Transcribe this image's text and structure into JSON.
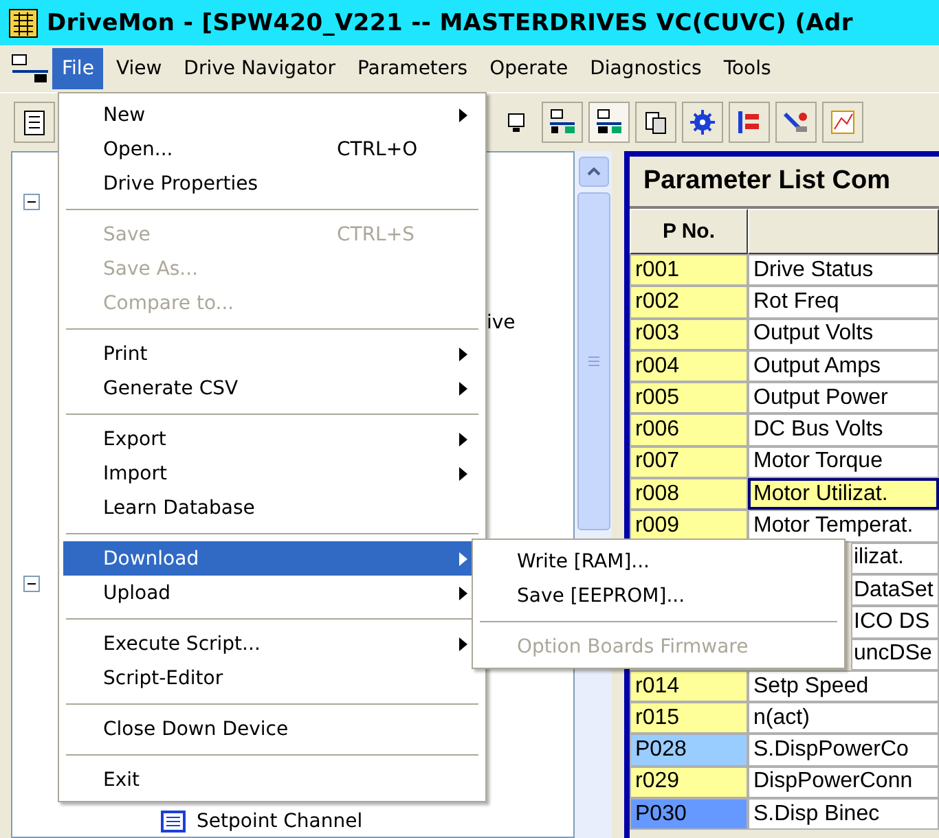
{
  "window": {
    "title": "DriveMon - [SPW420_V221 -- MASTERDRIVES VC(CUVC)  (Adr"
  },
  "menubar": [
    {
      "label": "File",
      "selected": true
    },
    {
      "label": "View",
      "selected": false
    },
    {
      "label": "Drive Navigator",
      "selected": false
    },
    {
      "label": "Parameters",
      "selected": false
    },
    {
      "label": "Operate",
      "selected": false
    },
    {
      "label": "Diagnostics",
      "selected": false
    },
    {
      "label": "Tools",
      "selected": false
    }
  ],
  "tree": {
    "nodes": [
      {
        "expanded": true
      },
      {
        "expanded": true
      }
    ],
    "fragment": "ive",
    "items": [
      {
        "label": "Setpoint Channel"
      }
    ]
  },
  "file_menu": {
    "items": [
      {
        "kind": "item",
        "label": "New",
        "submenu": true,
        "disabled": false,
        "selected": false
      },
      {
        "kind": "item",
        "label": "Open...",
        "shortcut": "CTRL+O",
        "submenu": false,
        "disabled": false,
        "selected": false
      },
      {
        "kind": "item",
        "label": "Drive Properties",
        "submenu": false,
        "disabled": false,
        "selected": false
      },
      {
        "kind": "separator"
      },
      {
        "kind": "item",
        "label": "Save",
        "shortcut": "CTRL+S",
        "submenu": false,
        "disabled": true,
        "selected": false
      },
      {
        "kind": "item",
        "label": "Save As...",
        "submenu": false,
        "disabled": true,
        "selected": false
      },
      {
        "kind": "item",
        "label": "Compare to...",
        "submenu": false,
        "disabled": true,
        "selected": false
      },
      {
        "kind": "separator"
      },
      {
        "kind": "item",
        "label": "Print",
        "submenu": true,
        "disabled": false,
        "selected": false
      },
      {
        "kind": "item",
        "label": "Generate CSV",
        "submenu": true,
        "disabled": false,
        "selected": false
      },
      {
        "kind": "separator"
      },
      {
        "kind": "item",
        "label": "Export",
        "submenu": true,
        "disabled": false,
        "selected": false
      },
      {
        "kind": "item",
        "label": "Import",
        "submenu": true,
        "disabled": false,
        "selected": false
      },
      {
        "kind": "item",
        "label": "Learn Database",
        "submenu": false,
        "disabled": false,
        "selected": false
      },
      {
        "kind": "separator"
      },
      {
        "kind": "item",
        "label": "Download",
        "submenu": true,
        "disabled": false,
        "selected": true
      },
      {
        "kind": "item",
        "label": "Upload",
        "submenu": true,
        "disabled": false,
        "selected": false
      },
      {
        "kind": "separator"
      },
      {
        "kind": "item",
        "label": "Execute Script...",
        "submenu": true,
        "disabled": false,
        "selected": false
      },
      {
        "kind": "item",
        "label": "Script-Editor",
        "submenu": false,
        "disabled": false,
        "selected": false
      },
      {
        "kind": "separator"
      },
      {
        "kind": "item",
        "label": "Close Down Device",
        "submenu": false,
        "disabled": false,
        "selected": false
      },
      {
        "kind": "separator"
      },
      {
        "kind": "item",
        "label": "Exit",
        "submenu": false,
        "disabled": false,
        "selected": false
      }
    ]
  },
  "download_submenu": {
    "items": [
      {
        "kind": "item",
        "label": "Write [RAM]...",
        "disabled": false,
        "selected": false
      },
      {
        "kind": "item",
        "label": "Save [EEPROM]...",
        "disabled": false,
        "selected": false
      },
      {
        "kind": "separator"
      },
      {
        "kind": "item",
        "label": "Option Boards Firmware",
        "disabled": true,
        "selected": false
      }
    ]
  },
  "parameter_list": {
    "title": "Parameter List Com",
    "columns": [
      "P No."
    ],
    "rows": [
      {
        "p_no": "r001",
        "description": "Drive Status",
        "color": "#ffff99",
        "selected": false,
        "partly_hidden": false
      },
      {
        "p_no": "r002",
        "description": "Rot Freq",
        "color": "#ffff99",
        "selected": false,
        "partly_hidden": false
      },
      {
        "p_no": "r003",
        "description": "Output Volts",
        "color": "#ffff99",
        "selected": false,
        "partly_hidden": false
      },
      {
        "p_no": "r004",
        "description": "Output Amps",
        "color": "#ffff99",
        "selected": false,
        "partly_hidden": false
      },
      {
        "p_no": "r005",
        "description": "Output Power",
        "color": "#ffff99",
        "selected": false,
        "partly_hidden": false
      },
      {
        "p_no": "r006",
        "description": "DC Bus Volts",
        "color": "#ffff99",
        "selected": false,
        "partly_hidden": false
      },
      {
        "p_no": "r007",
        "description": "Motor Torque",
        "color": "#ffff99",
        "selected": false,
        "partly_hidden": false
      },
      {
        "p_no": "r008",
        "description": "Motor Utilizat.",
        "color": "#ffff99",
        "selected": true,
        "partly_hidden": false
      },
      {
        "p_no": "r009",
        "description": "Motor Temperat.",
        "color": "#ffff99",
        "selected": false,
        "partly_hidden": false
      },
      {
        "description": "ilizat.",
        "selected": false,
        "partly_hidden": true
      },
      {
        "description": "DataSet",
        "selected": false,
        "partly_hidden": true
      },
      {
        "description": "ICO DS",
        "selected": false,
        "partly_hidden": true
      },
      {
        "description": "uncDSe",
        "selected": false,
        "partly_hidden": true
      },
      {
        "p_no": "r014",
        "description": "Setp Speed",
        "color": "#ffff99",
        "selected": false,
        "partly_hidden": false
      },
      {
        "p_no": "r015",
        "description": "n(act)",
        "color": "#ffff99",
        "selected": false,
        "partly_hidden": false
      },
      {
        "p_no": "P028",
        "description": "S.DispPowerCo",
        "color": "#99ccff",
        "selected": false,
        "partly_hidden": false
      },
      {
        "p_no": "r029",
        "description": "DispPowerConn",
        "color": "#ffff99",
        "selected": false,
        "partly_hidden": false
      },
      {
        "p_no": "P030",
        "description": "S.Disp Binec",
        "color": "#6699ff",
        "selected": false,
        "partly_hidden": false
      }
    ]
  }
}
